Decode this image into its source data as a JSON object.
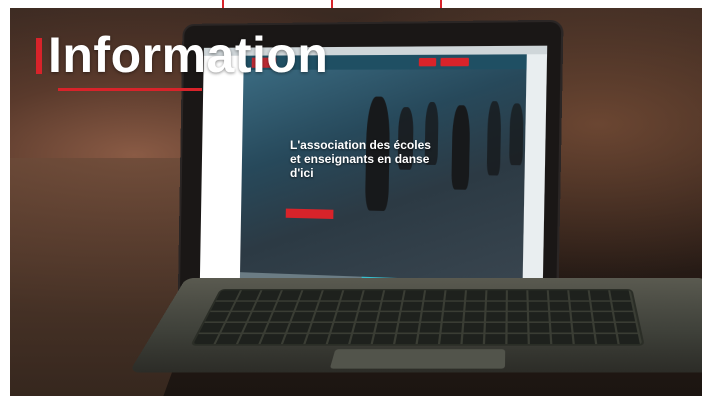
{
  "overlay": {
    "heading": "Information",
    "accent_color": "#d8232a"
  },
  "laptop_screen": {
    "hero_title": "L'association des écoles et enseignants en danse d'ici",
    "nav_color": "#1f4f63",
    "cta_color": "#d8232a"
  }
}
